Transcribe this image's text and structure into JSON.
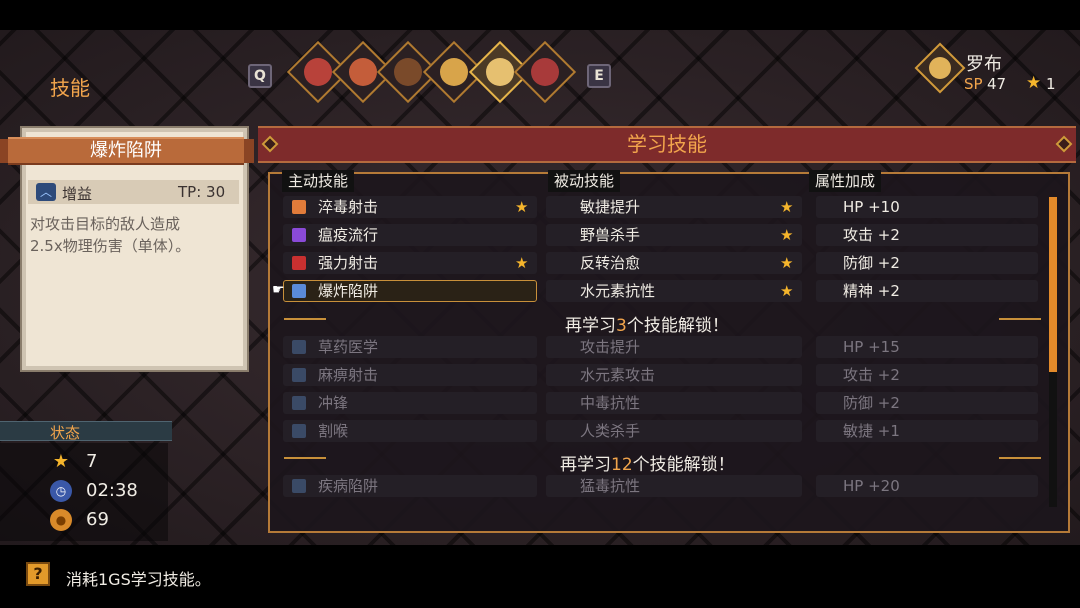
{
  "header": {
    "page_title": "技能",
    "key_prev": "Q",
    "key_next": "E",
    "character": {
      "name": "罗布",
      "sp_label": "SP",
      "sp_value": "47",
      "stars": "1"
    }
  },
  "party_portraits": [
    {
      "name": "portrait-1",
      "color": "#b8423a"
    },
    {
      "name": "portrait-2",
      "color": "#c45d3a"
    },
    {
      "name": "portrait-3",
      "color": "#7a4a2a"
    },
    {
      "name": "portrait-4",
      "color": "#d8a44a"
    },
    {
      "name": "portrait-5",
      "color": "#e6c070",
      "active": true
    },
    {
      "name": "portrait-6",
      "color": "#a83a3a"
    }
  ],
  "detail": {
    "title": "爆炸陷阱",
    "type_label": "增益",
    "tp": "TP: 30",
    "description_line1": "对攻击目标的敌人造成",
    "description_line2": "2.5x物理伤害（单体）。"
  },
  "status": {
    "title": "状态",
    "stars": "7",
    "time": "02:38",
    "gold": "69"
  },
  "main": {
    "title": "学习技能",
    "columns": {
      "active": "主动技能",
      "passive": "被动技能",
      "attribute": "属性加成"
    },
    "unlock1": {
      "prefix": "再学习",
      "count": "3",
      "suffix": "个技能解锁！"
    },
    "unlock2": {
      "prefix": "再学习",
      "count": "12",
      "suffix": "个技能解锁！"
    },
    "rows": [
      {
        "active": "淬毒射击",
        "active_star": true,
        "passive": "敏捷提升",
        "passive_star": true,
        "attr": "HP +10",
        "dim": false
      },
      {
        "active": "瘟疫流行",
        "active_star": false,
        "passive": "野兽杀手",
        "passive_star": true,
        "attr": "攻击 +2",
        "dim": false
      },
      {
        "active": "强力射击",
        "active_star": true,
        "passive": "反转治愈",
        "passive_star": true,
        "attr": "防御 +2",
        "dim": false
      },
      {
        "active": "爆炸陷阱",
        "active_star": false,
        "passive": "水元素抗性",
        "passive_star": true,
        "attr": "精神 +2",
        "dim": false
      },
      {
        "active": "草药医学",
        "passive": "攻击提升",
        "attr": "HP +15",
        "dim": true
      },
      {
        "active": "麻痹射击",
        "passive": "水元素攻击",
        "attr": "攻击 +2",
        "dim": true
      },
      {
        "active": "冲锋",
        "passive": "中毒抗性",
        "attr": "防御 +2",
        "dim": true
      },
      {
        "active": "割喉",
        "passive": "人类杀手",
        "attr": "敏捷 +1",
        "dim": true
      },
      {
        "active": "疾病陷阱",
        "passive": "猛毒抗性",
        "attr": "HP +20",
        "dim": true
      }
    ]
  },
  "hint": {
    "icon": "?",
    "text": "消耗1GS学习技能。"
  }
}
